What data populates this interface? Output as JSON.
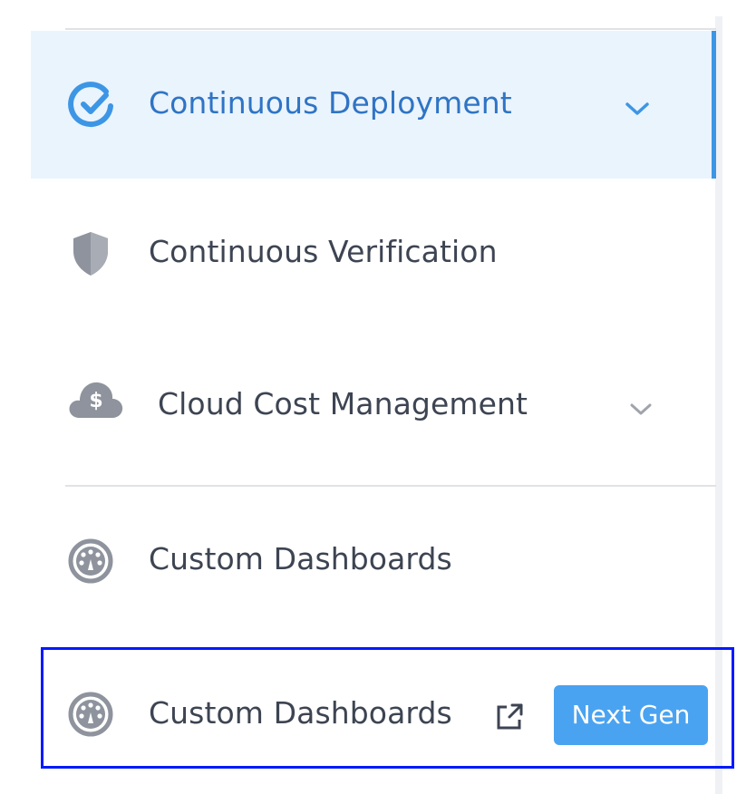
{
  "colors": {
    "accent": "#3d96e5",
    "active_bg": "#eaf4fd",
    "badge": "#4aa3f0",
    "icon_gray": "#8e939d",
    "highlight": "#0019ff"
  },
  "nav": {
    "items": [
      {
        "label": "Continuous Deployment",
        "icon": "check-circle-icon",
        "expandable": true,
        "active": true
      },
      {
        "label": "Continuous Verification",
        "icon": "shield-icon",
        "expandable": false
      },
      {
        "label": "Cloud Cost Management",
        "icon": "cloud-dollar-icon",
        "expandable": true
      },
      {
        "label": "Custom Dashboards",
        "icon": "dashboard-gauge-icon",
        "expandable": false
      },
      {
        "label": "Custom Dashboards",
        "icon": "dashboard-gauge-icon",
        "external_link_icon": "external-link-icon",
        "badge": "Next Gen"
      }
    ]
  }
}
